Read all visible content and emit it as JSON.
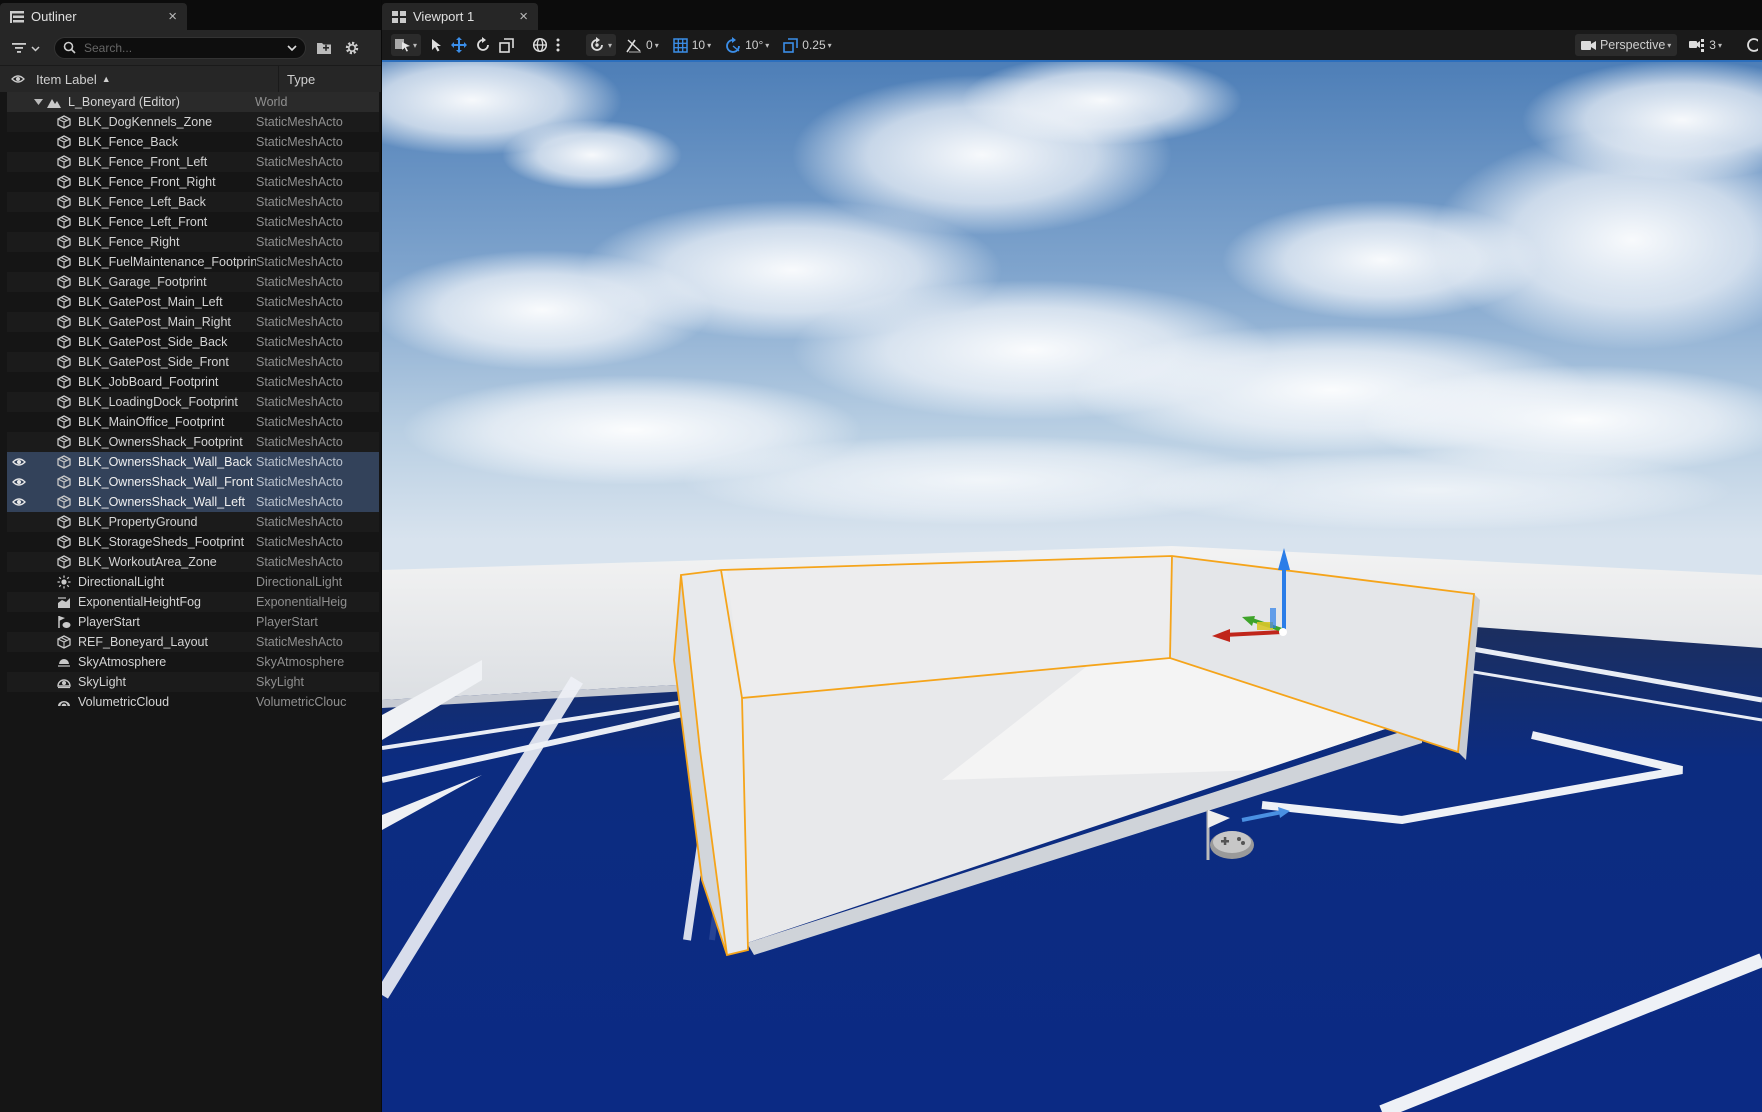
{
  "outliner": {
    "tab_title": "Outliner",
    "search": {
      "placeholder": "Search..."
    },
    "headers": {
      "label": "Item Label",
      "sort": "▲",
      "type": "Type"
    },
    "world": {
      "label": "L_Boneyard (Editor)",
      "type": "World"
    },
    "items": [
      {
        "label": "BLK_DogKennels_Zone",
        "type": "StaticMeshActo",
        "icon": "static-mesh-icon",
        "selected": false
      },
      {
        "label": "BLK_Fence_Back",
        "type": "StaticMeshActo",
        "icon": "static-mesh-icon",
        "selected": false
      },
      {
        "label": "BLK_Fence_Front_Left",
        "type": "StaticMeshActo",
        "icon": "static-mesh-icon",
        "selected": false
      },
      {
        "label": "BLK_Fence_Front_Right",
        "type": "StaticMeshActo",
        "icon": "static-mesh-icon",
        "selected": false
      },
      {
        "label": "BLK_Fence_Left_Back",
        "type": "StaticMeshActo",
        "icon": "static-mesh-icon",
        "selected": false
      },
      {
        "label": "BLK_Fence_Left_Front",
        "type": "StaticMeshActo",
        "icon": "static-mesh-icon",
        "selected": false
      },
      {
        "label": "BLK_Fence_Right",
        "type": "StaticMeshActo",
        "icon": "static-mesh-icon",
        "selected": false
      },
      {
        "label": "BLK_FuelMaintenance_Footprint",
        "type": "StaticMeshActo",
        "icon": "static-mesh-icon",
        "selected": false
      },
      {
        "label": "BLK_Garage_Footprint",
        "type": "StaticMeshActo",
        "icon": "static-mesh-icon",
        "selected": false
      },
      {
        "label": "BLK_GatePost_Main_Left",
        "type": "StaticMeshActo",
        "icon": "static-mesh-icon",
        "selected": false
      },
      {
        "label": "BLK_GatePost_Main_Right",
        "type": "StaticMeshActo",
        "icon": "static-mesh-icon",
        "selected": false
      },
      {
        "label": "BLK_GatePost_Side_Back",
        "type": "StaticMeshActo",
        "icon": "static-mesh-icon",
        "selected": false
      },
      {
        "label": "BLK_GatePost_Side_Front",
        "type": "StaticMeshActo",
        "icon": "static-mesh-icon",
        "selected": false
      },
      {
        "label": "BLK_JobBoard_Footprint",
        "type": "StaticMeshActo",
        "icon": "static-mesh-icon",
        "selected": false
      },
      {
        "label": "BLK_LoadingDock_Footprint",
        "type": "StaticMeshActo",
        "icon": "static-mesh-icon",
        "selected": false
      },
      {
        "label": "BLK_MainOffice_Footprint",
        "type": "StaticMeshActo",
        "icon": "static-mesh-icon",
        "selected": false
      },
      {
        "label": "BLK_OwnersShack_Footprint",
        "type": "StaticMeshActo",
        "icon": "static-mesh-icon",
        "selected": false
      },
      {
        "label": "BLK_OwnersShack_Wall_Back",
        "type": "StaticMeshActo",
        "icon": "static-mesh-icon",
        "selected": true
      },
      {
        "label": "BLK_OwnersShack_Wall_Front",
        "type": "StaticMeshActo",
        "icon": "static-mesh-icon",
        "selected": true
      },
      {
        "label": "BLK_OwnersShack_Wall_Left",
        "type": "StaticMeshActo",
        "icon": "static-mesh-icon",
        "selected": true
      },
      {
        "label": "BLK_PropertyGround",
        "type": "StaticMeshActo",
        "icon": "static-mesh-icon",
        "selected": false
      },
      {
        "label": "BLK_StorageSheds_Footprint",
        "type": "StaticMeshActo",
        "icon": "static-mesh-icon",
        "selected": false
      },
      {
        "label": "BLK_WorkoutArea_Zone",
        "type": "StaticMeshActo",
        "icon": "static-mesh-icon",
        "selected": false
      },
      {
        "label": "DirectionalLight",
        "type": "DirectionalLight",
        "icon": "sun-icon",
        "selected": false
      },
      {
        "label": "ExponentialHeightFog",
        "type": "ExponentialHeig",
        "icon": "fog-icon",
        "selected": false
      },
      {
        "label": "PlayerStart",
        "type": "PlayerStart",
        "icon": "player-start-icon",
        "selected": false
      },
      {
        "label": "REF_Boneyard_Layout",
        "type": "StaticMeshActo",
        "icon": "static-mesh-icon",
        "selected": false
      },
      {
        "label": "SkyAtmosphere",
        "type": "SkyAtmosphere",
        "icon": "sky-atmosphere-icon",
        "selected": false
      },
      {
        "label": "SkyLight",
        "type": "SkyLight",
        "icon": "skylight-icon",
        "selected": false
      },
      {
        "label": "VolumetricCloud",
        "type": "VolumetricClouc",
        "icon": "cloud-icon",
        "selected": false
      }
    ]
  },
  "viewport": {
    "tab_title": "Viewport 1",
    "toolbar": {
      "surface_snap_value": "0",
      "grid_snap_value": "10",
      "rotation_snap_value": "10°",
      "scale_snap_value": "0.25",
      "view_mode": "Perspective",
      "camera_speed": "3"
    },
    "colors": {
      "selection_outline": "#f5a41a",
      "ground": "#0c2a7c",
      "sky_top": "#4f7fb8"
    }
  }
}
